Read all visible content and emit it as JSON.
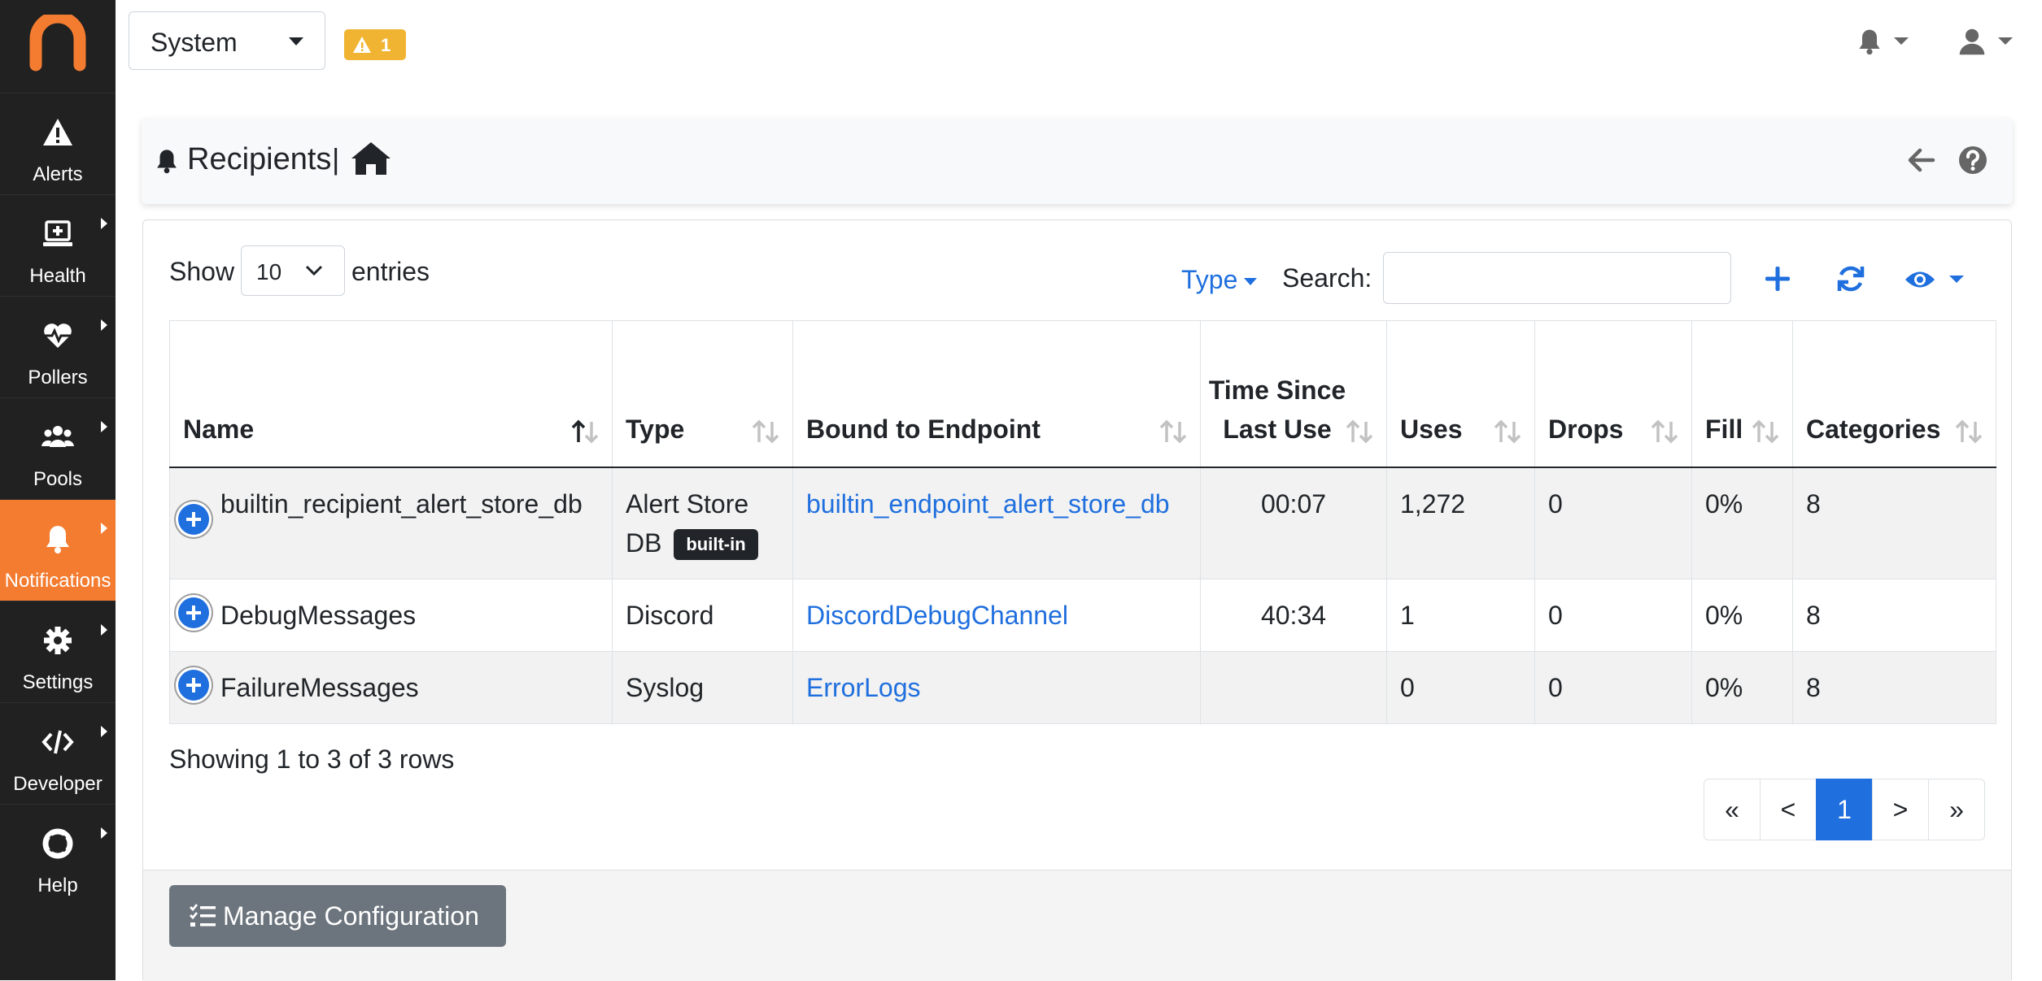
{
  "sidebar": {
    "items": [
      {
        "label": "Alerts",
        "icon": "warning-icon"
      },
      {
        "label": "Health",
        "icon": "monitor-plus-icon"
      },
      {
        "label": "Pollers",
        "icon": "heartbeat-icon"
      },
      {
        "label": "Pools",
        "icon": "users-icon"
      },
      {
        "label": "Notifications",
        "icon": "bell-icon"
      },
      {
        "label": "Settings",
        "icon": "gear-icon"
      },
      {
        "label": "Developer",
        "icon": "code-icon"
      },
      {
        "label": "Help",
        "icon": "lifebuoy-icon"
      }
    ],
    "active": "Notifications",
    "accent": "#f47c30",
    "background": "#212121"
  },
  "topbar": {
    "system_select": "System",
    "alert_count": "1",
    "warning_color": "#f0b432"
  },
  "page_header": {
    "title": "Recipients",
    "separator": "|"
  },
  "controls": {
    "show_label": "Show",
    "entries_value": "10",
    "entries_label": "entries",
    "type_filter": "Type",
    "search_label": "Search:",
    "search_value": "",
    "link_color": "#1f6fde"
  },
  "table": {
    "columns": [
      "Name",
      "Type",
      "Bound to Endpoint",
      "Time Since Last Use",
      "Uses",
      "Drops",
      "Fill",
      "Categories"
    ],
    "rows": [
      {
        "name": "builtin_recipient_alert_store_db",
        "type": "Alert Store DB",
        "badge": "built-in",
        "endpoint": "builtin_endpoint_alert_store_db",
        "time": "00:07",
        "uses": "1,272",
        "drops": "0",
        "fill": "0%",
        "categories": "8"
      },
      {
        "name": "DebugMessages",
        "type": "Discord",
        "badge": "",
        "endpoint": "DiscordDebugChannel",
        "time": "40:34",
        "uses": "1",
        "drops": "0",
        "fill": "0%",
        "categories": "8"
      },
      {
        "name": "FailureMessages",
        "type": "Syslog",
        "badge": "",
        "endpoint": "ErrorLogs",
        "time": "",
        "uses": "0",
        "drops": "0",
        "fill": "0%",
        "categories": "8"
      }
    ]
  },
  "footer": {
    "showing": "Showing 1 to 3 of 3 rows",
    "pagination": [
      "«",
      "<",
      "1",
      ">",
      "»"
    ],
    "current_page": "1",
    "manage_button": "Manage Configuration"
  }
}
